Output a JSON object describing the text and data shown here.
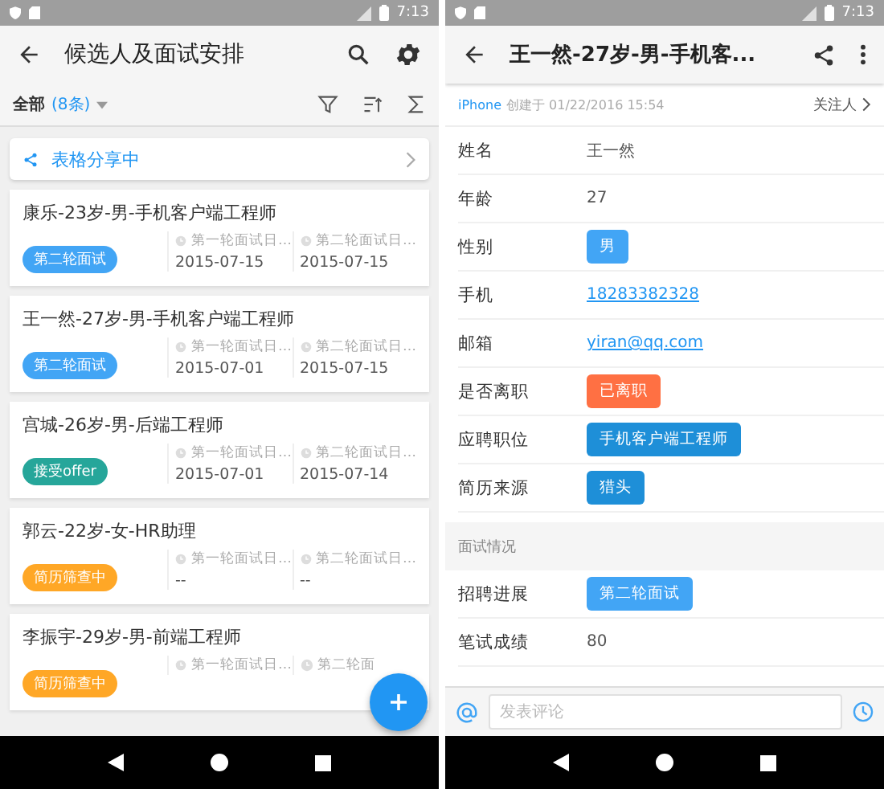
{
  "left": {
    "status_time": "7:13",
    "title": "候选人及面试安排",
    "filter": {
      "label": "全部",
      "count": "(8条)"
    },
    "share_banner": "表格分享中",
    "cards": [
      {
        "title": "康乐-23岁-男-手机客户端工程师",
        "status": {
          "label": "第二轮面试",
          "color": "#42a5f5"
        },
        "dates": [
          {
            "label": "第一轮面试日…",
            "value": "2015-07-15"
          },
          {
            "label": "第二轮面试日…",
            "value": "2015-07-15"
          }
        ]
      },
      {
        "title": "王一然-27岁-男-手机客户端工程师",
        "status": {
          "label": "第二轮面试",
          "color": "#42a5f5"
        },
        "dates": [
          {
            "label": "第一轮面试日…",
            "value": "2015-07-01"
          },
          {
            "label": "第二轮面试日…",
            "value": "2015-07-15"
          }
        ]
      },
      {
        "title": "宫城-26岁-男-后端工程师",
        "status": {
          "label": "接受offer",
          "color": "#26a69a"
        },
        "dates": [
          {
            "label": "第一轮面试日…",
            "value": "2015-07-01"
          },
          {
            "label": "第二轮面试日…",
            "value": "2015-07-14"
          }
        ]
      },
      {
        "title": "郭云-22岁-女-HR助理",
        "status": {
          "label": "简历筛查中",
          "color": "#ffa726"
        },
        "dates": [
          {
            "label": "第一轮面试日…",
            "value": "--"
          },
          {
            "label": "第二轮面试日…",
            "value": "--"
          }
        ]
      },
      {
        "title": "李振宇-29岁-男-前端工程师",
        "status": {
          "label": "简历筛查中",
          "color": "#ffa726"
        },
        "dates": [
          {
            "label": "第一轮面试日…"
          },
          {
            "label": "第二轮面"
          }
        ]
      }
    ]
  },
  "right": {
    "status_time": "7:13",
    "title": "王一然-27岁-男-手机客...",
    "meta": {
      "source": "iPhone",
      "created": "创建于 01/22/2016 15:54",
      "follow": "关注人"
    },
    "fields": [
      {
        "label": "姓名",
        "kind": "text",
        "value": "王一然"
      },
      {
        "label": "年龄",
        "kind": "text",
        "value": "27"
      },
      {
        "label": "性别",
        "kind": "tag",
        "value": "男",
        "color": "#42a5f5"
      },
      {
        "label": "手机",
        "kind": "link",
        "value": "18283382328"
      },
      {
        "label": "邮箱",
        "kind": "link",
        "value": "yiran@qq.com"
      },
      {
        "label": "是否离职",
        "kind": "tag",
        "value": "已离职",
        "color": "#ff7043"
      },
      {
        "label": "应聘职位",
        "kind": "tag",
        "value": "手机客户端工程师",
        "color": "#1e8fd8"
      },
      {
        "label": "简历来源",
        "kind": "tag",
        "value": "猎头",
        "color": "#1e8fd8"
      }
    ],
    "section": "面试情况",
    "progress_fields": [
      {
        "label": "招聘进展",
        "kind": "tag",
        "value": "第二轮面试",
        "color": "#42a5f5"
      },
      {
        "label": "笔试成绩",
        "kind": "text",
        "value": "80"
      }
    ],
    "comment": {
      "placeholder": "发表评论"
    }
  }
}
